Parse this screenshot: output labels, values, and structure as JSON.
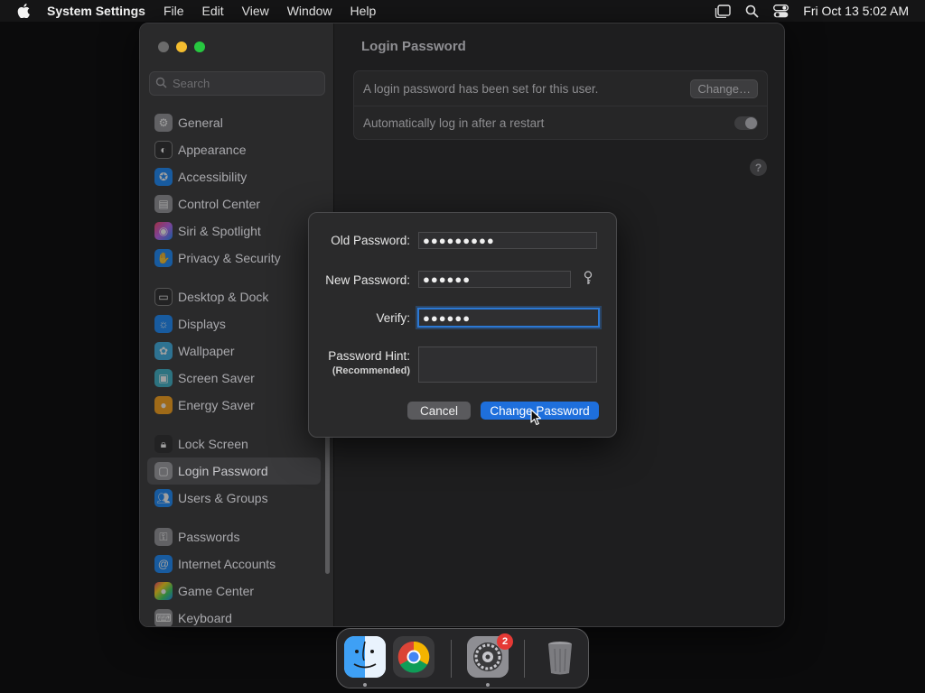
{
  "menubar": {
    "app_name": "System Settings",
    "menus": [
      "File",
      "Edit",
      "View",
      "Window",
      "Help"
    ],
    "clock": "Fri Oct 13  5:02 AM"
  },
  "sidebar": {
    "search_placeholder": "Search",
    "items": [
      {
        "label": "General",
        "icon": "gear-icon",
        "color": "#8e8e93"
      },
      {
        "label": "Appearance",
        "icon": "appearance-icon",
        "color": "#1c1c1e"
      },
      {
        "label": "Accessibility",
        "icon": "accessibility-icon",
        "color": "#0a84ff"
      },
      {
        "label": "Control Center",
        "icon": "control-center-icon",
        "color": "#8e8e93"
      },
      {
        "label": "Siri & Spotlight",
        "icon": "siri-icon",
        "color": "#bf5af2"
      },
      {
        "label": "Privacy & Security",
        "icon": "hand-icon",
        "color": "#0a84ff"
      },
      {
        "label": "Desktop & Dock",
        "icon": "dock-icon",
        "color": "#1c1c1e"
      },
      {
        "label": "Displays",
        "icon": "sun-icon",
        "color": "#0a84ff"
      },
      {
        "label": "Wallpaper",
        "icon": "wallpaper-icon",
        "color": "#32ade6"
      },
      {
        "label": "Screen Saver",
        "icon": "screen-saver-icon",
        "color": "#30b0c7"
      },
      {
        "label": "Energy Saver",
        "icon": "bulb-icon",
        "color": "#ff9f0a"
      },
      {
        "label": "Lock Screen",
        "icon": "lock-icon",
        "color": "#1c1c1e"
      },
      {
        "label": "Login Password",
        "icon": "login-password-icon",
        "color": "#8e8e93"
      },
      {
        "label": "Users & Groups",
        "icon": "users-icon",
        "color": "#0a84ff"
      },
      {
        "label": "Passwords",
        "icon": "key-icon",
        "color": "#8e8e93"
      },
      {
        "label": "Internet Accounts",
        "icon": "at-icon",
        "color": "#0a84ff"
      },
      {
        "label": "Game Center",
        "icon": "game-center-icon",
        "color": "#ff375f"
      },
      {
        "label": "Keyboard",
        "icon": "keyboard-icon",
        "color": "#8e8e93"
      }
    ],
    "selected": "Login Password"
  },
  "content": {
    "title": "Login Password",
    "password_status": "A login password has been set for this user.",
    "change_button": "Change…",
    "auto_login_label": "Automatically log in after a restart",
    "auto_login_enabled": false,
    "help": "?"
  },
  "dialog": {
    "old_password_label": "Old Password:",
    "old_password_value": "●●●●●●●●●",
    "new_password_label": "New Password:",
    "new_password_value": "●●●●●●",
    "verify_label": "Verify:",
    "verify_value": "●●●●●●",
    "hint_label": "Password Hint:",
    "hint_sublabel": "(Recommended)",
    "hint_value": "",
    "cancel_button": "Cancel",
    "confirm_button": "Change Password"
  },
  "dock": {
    "apps": [
      "Finder",
      "Chrome",
      "System Settings",
      "Trash"
    ],
    "badge_count": "2"
  }
}
